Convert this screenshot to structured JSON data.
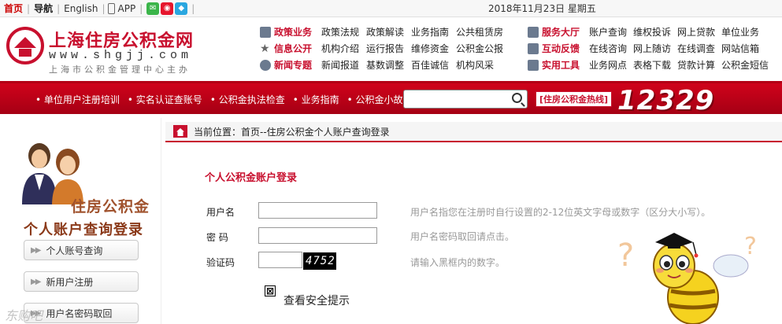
{
  "topbar": {
    "home": "首页",
    "nav": "导航",
    "english": "English",
    "app": "APP",
    "date": "2018年11月23日  星期五"
  },
  "brand": {
    "name": "上海住房公积金网",
    "url": "www.shgjj.com",
    "sub": "上海市公积金管理中心主办"
  },
  "nav_left": [
    {
      "cat": "政策业务",
      "items": [
        "政策法规",
        "政策解读",
        "业务指南",
        "公共租赁房"
      ]
    },
    {
      "cat": "信息公开",
      "items": [
        "机构介绍",
        "运行报告",
        "维修资金",
        "公积金公报"
      ]
    },
    {
      "cat": "新闻专题",
      "items": [
        "新闻报道",
        "基数调整",
        "百佳诚信",
        "机构风采"
      ]
    }
  ],
  "nav_right": [
    {
      "cat": "服务大厅",
      "items": [
        "账户查询",
        "维权投诉",
        "网上贷款",
        "单位业务"
      ]
    },
    {
      "cat": "互动反馈",
      "items": [
        "在线咨询",
        "网上随访",
        "在线调查",
        "网站信箱"
      ]
    },
    {
      "cat": "实用工具",
      "items": [
        "业务网点",
        "表格下载",
        "贷款计算",
        "公积金短信"
      ]
    }
  ],
  "redbar": {
    "menu": [
      "• 单位用户注册培训",
      "• 实名认证查账号",
      "• 公积金执法检查",
      "• 业务指南",
      "• 公积金小故事"
    ],
    "search_placeholder": "",
    "hotline_label": "[住房公积金热线]",
    "hotline": "12329"
  },
  "left": {
    "banner_line1": "住房公积金",
    "banner_line2": "个人账户查询登录",
    "buttons": [
      "个人账号查询",
      "新用户注册",
      "用户名密码取回"
    ]
  },
  "breadcrumb": "当前位置：首页--住房公积金个人账户查询登录",
  "form": {
    "title": "个人公积金账户登录",
    "username_label": "用户名",
    "password_label": "密  码",
    "captcha_label": "验证码",
    "captcha_code": "4752",
    "username_hint": "用户名指您在注册时自行设置的2-12位英文字母或数字（区分大小写）。",
    "password_hint": "用户名密码取回请点击。",
    "captcha_hint": "请输入黑框内的数字。",
    "safety_icon": "⊠",
    "safety_link": "查看安全提示"
  },
  "watermark": "东购吧"
}
